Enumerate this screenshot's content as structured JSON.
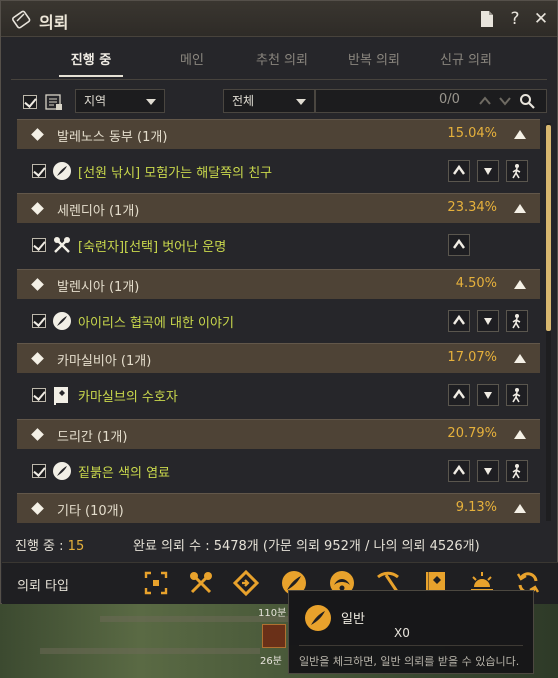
{
  "window": {
    "title": "의뢰"
  },
  "tabs": [
    {
      "label": "진행 중",
      "active": true
    },
    {
      "label": "메인",
      "active": false
    },
    {
      "label": "추천 의뢰",
      "active": false
    },
    {
      "label": "반복 의뢰",
      "active": false
    },
    {
      "label": "신규 의뢰",
      "active": false
    }
  ],
  "filter": {
    "region_select": "지역",
    "scope_select": "전체",
    "search_count": "0/0"
  },
  "groups": [
    {
      "name": "발레노스 동부 (1개)",
      "percent": "15.04%",
      "quest": {
        "name": "[선원 낚시] 모험가는 해달쪽의 친구",
        "icon": "feather-icon",
        "buttons": [
          "up",
          "down",
          "walk"
        ]
      }
    },
    {
      "name": "세렌디아 (1개)",
      "percent": "23.34%",
      "quest": {
        "name": "[숙련자][선택] 벗어난 운명",
        "icon": "crossed-tools-icon",
        "buttons": [
          "up"
        ]
      }
    },
    {
      "name": "발렌시아 (1개)",
      "percent": "4.50%",
      "quest": {
        "name": "아이리스 협곡에 대한 이야기",
        "icon": "feather-icon",
        "buttons": [
          "up",
          "down",
          "walk"
        ]
      }
    },
    {
      "name": "카마실비아 (1개)",
      "percent": "17.07%",
      "quest": {
        "name": "카마실브의 수호자",
        "icon": "banner-icon",
        "buttons": [
          "up",
          "down",
          "walk"
        ]
      }
    },
    {
      "name": "드리간 (1개)",
      "percent": "20.79%",
      "quest": {
        "name": "짙붉은 색의 염료",
        "icon": "feather-icon",
        "buttons": [
          "up",
          "down",
          "walk"
        ]
      }
    },
    {
      "name": "기타 (10개)",
      "percent": "9.13%",
      "quest": null
    }
  ],
  "status": {
    "in_progress_label": "진행 중 :",
    "in_progress_count": "15",
    "completed_text": "완료 의뢰 수 : 5478개 (가문 의뢰 952개 / 나의 의뢰 4526개)"
  },
  "quest_types": {
    "label": "의뢰 타입",
    "icons": [
      "target-icon",
      "crossed-tools-icon",
      "diamond-arrow-icon",
      "feather-icon",
      "compass-icon",
      "pickaxe-icon",
      "banner-icon",
      "sunrise-icon",
      "refresh-icon"
    ]
  },
  "tooltip": {
    "name": "일반",
    "description": "일반을 체크하면, 일반 의뢰를 받을 수 있습니다."
  },
  "background": {
    "timer_top": "110분",
    "timer_bottom": "26분",
    "x_label": "X0"
  },
  "colors": {
    "accent_gold": "#e6b13c",
    "quest_green": "#c9d84c",
    "group_bg": "#4e4336"
  }
}
